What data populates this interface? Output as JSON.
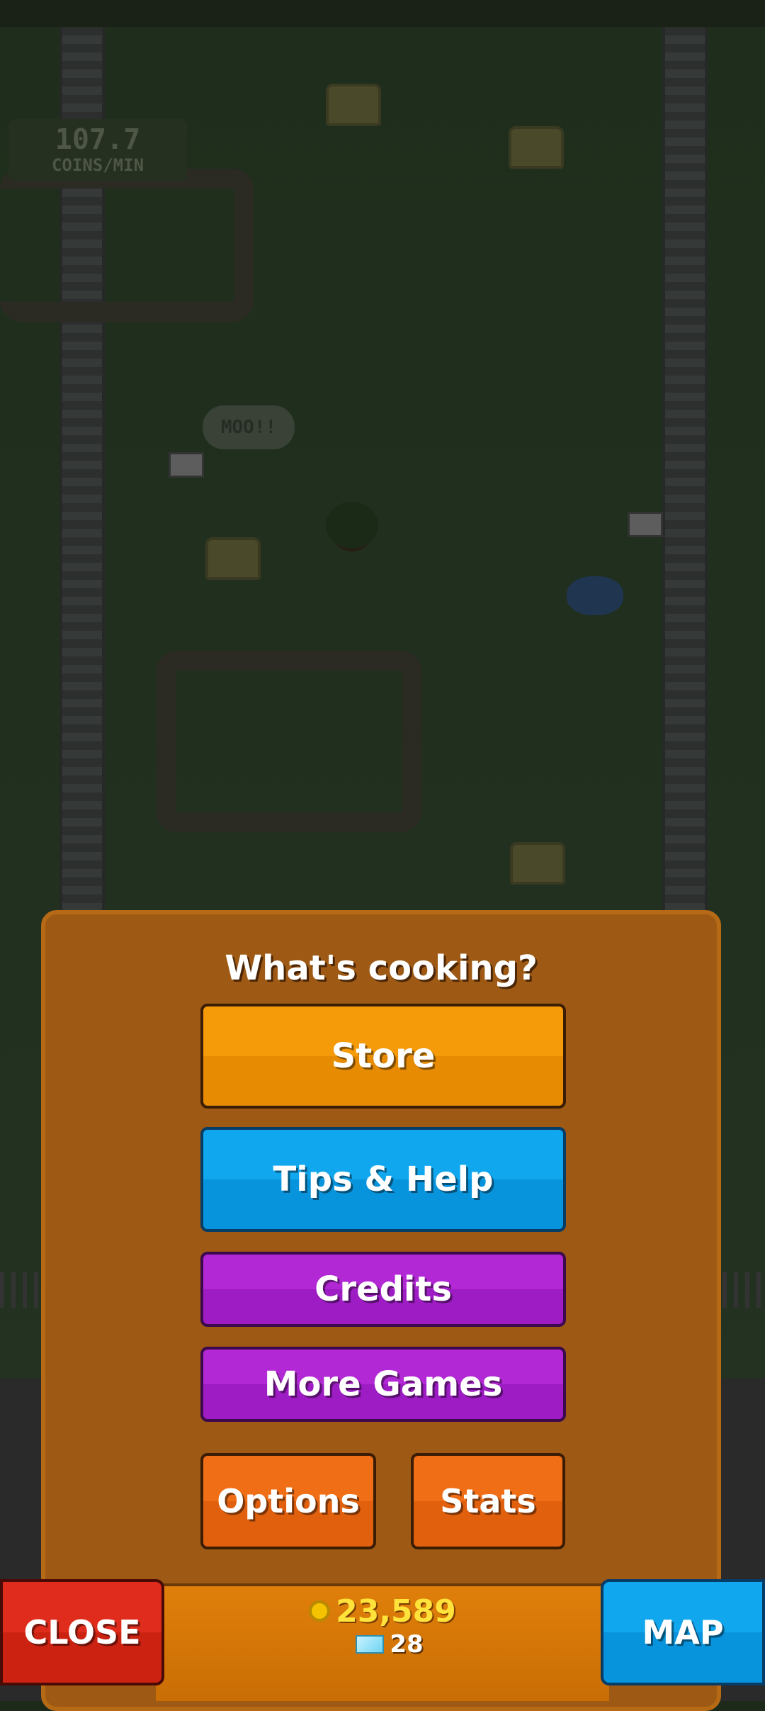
{
  "hud": {
    "coins_per_min_value": "107.7",
    "coins_per_min_label": "COINS/MIN",
    "speech_bubble": "MOO!!"
  },
  "menu": {
    "title": "What's cooking?",
    "store_label": "Store",
    "tips_label": "Tips & Help",
    "credits_label": "Credits",
    "more_games_label": "More Games",
    "options_label": "Options",
    "stats_label": "Stats"
  },
  "bottom_bar": {
    "close_label": "CLOSE",
    "map_label": "MAP",
    "coins": "23,589",
    "gems": "28"
  },
  "icons": {
    "coin": "coin-icon",
    "gem": "gem-icon"
  },
  "colors": {
    "panel": "#9e5a14",
    "store": "#f59a08",
    "tips": "#10a7ee",
    "purple": "#b228d4",
    "orange": "#f06e16",
    "close": "#e02c1c",
    "map": "#10a7ee",
    "coin_text": "#ffe23a"
  }
}
